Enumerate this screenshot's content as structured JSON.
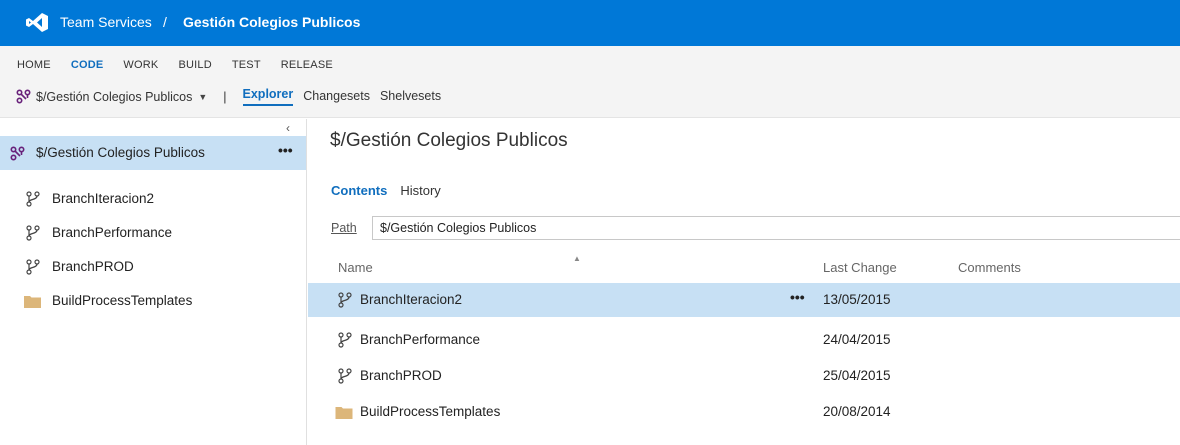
{
  "topbar": {
    "brand": "Team Services",
    "separator": "/",
    "project": "Gestión Colegios Publicos"
  },
  "hubs": [
    "HOME",
    "CODE",
    "WORK",
    "BUILD",
    "TEST",
    "RELEASE"
  ],
  "active_hub": "CODE",
  "subnav": {
    "repo": "$/Gestión Colegios Publicos",
    "caret": "▼",
    "pipe": "|",
    "tabs": [
      "Explorer",
      "Changesets",
      "Shelvesets"
    ],
    "active_tab": "Explorer"
  },
  "tree": {
    "collapse_glyph": "‹",
    "root": {
      "label": "$/Gestión Colegios Publicos",
      "more": "•••",
      "icon": "repo-icon"
    },
    "items": [
      {
        "label": "BranchIteracion2",
        "icon": "branch-icon"
      },
      {
        "label": "BranchPerformance",
        "icon": "branch-icon"
      },
      {
        "label": "BranchPROD",
        "icon": "branch-icon"
      },
      {
        "label": "BuildProcessTemplates",
        "icon": "folder-icon"
      }
    ]
  },
  "main": {
    "title": "$/Gestión Colegios Publicos",
    "tabs": [
      "Contents",
      "History"
    ],
    "active_tab": "Contents",
    "path_label": "Path",
    "path_value": "$/Gestión Colegios Publicos",
    "columns": {
      "name": "Name",
      "last_change": "Last Change",
      "comments": "Comments"
    },
    "sort_indicator": "▲",
    "rows": [
      {
        "name": "BranchIteracion2",
        "date": "13/05/2015",
        "comment": "",
        "icon": "branch-icon",
        "selected": true,
        "more": "•••"
      },
      {
        "name": "BranchPerformance",
        "date": "24/04/2015",
        "comment": "",
        "icon": "branch-icon"
      },
      {
        "name": "BranchPROD",
        "date": "25/04/2015",
        "comment": "",
        "icon": "branch-icon"
      },
      {
        "name": "BuildProcessTemplates",
        "date": "20/08/2014",
        "comment": "",
        "icon": "folder-icon"
      }
    ]
  },
  "colors": {
    "topbar": "#0078d7",
    "accent": "#106ebe",
    "selection": "#c7e0f4",
    "folder": "#dcb67a",
    "repo_icon": "#68217a"
  }
}
